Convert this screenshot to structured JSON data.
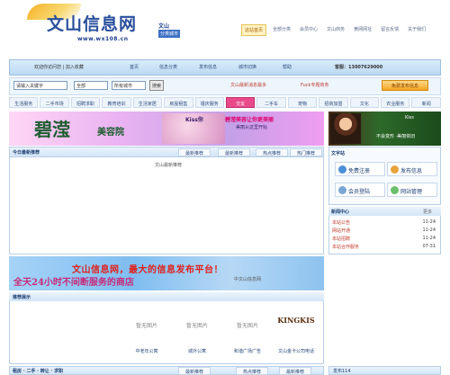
{
  "header": {
    "logo_title": "文山信息网",
    "logo_url": "www.wx108.cn",
    "logo_tag1": "文山",
    "logo_tag2": "分类城市",
    "nav": [
      "这站首页",
      "全部分类",
      "会员中心",
      "文山商务",
      "黄网网址",
      "留言反馈",
      "关于我们"
    ]
  },
  "menubar": {
    "left_text": "欢迎你访问您 | 加入收藏",
    "tabs": [
      "首页",
      "信息分类",
      "发布信息",
      "城市切换",
      "帮助"
    ],
    "phone": "客服：13007629000"
  },
  "search": {
    "input_value": "请输入关键字",
    "select1": "全部",
    "select2": "所有城市",
    "button": "搜索",
    "hint1": "文山最新消息最多",
    "hint2": "Fuck专题商务",
    "post_button": "免费发布信息"
  },
  "categories": [
    "生活服务",
    "二手市场",
    "招聘求职",
    "教育培训",
    "生活家居",
    "房屋租售",
    "婚庆服务",
    "交友",
    "二手车",
    "宠物",
    "招商加盟",
    "文化",
    "农业服务",
    "新闻"
  ],
  "banner": {
    "logo": "碧滢",
    "sub": "美容院",
    "text1": "Kiss你",
    "text2": "碧滢美容让你更美丽",
    "text3": "美丽从这里开始",
    "right_text1": "Kiss",
    "right_text2": "不会变形 ·美丽依旧"
  },
  "listing": {
    "title": "今日最新推荐",
    "tabs": [
      "最新推荐",
      "最新推荐",
      "热点推荐",
      "热门推荐"
    ],
    "empty": "文山最新推荐"
  },
  "sidebar": {
    "head": "文字站",
    "buttons": [
      "免费注册",
      "发布信息",
      "会员登陆",
      "网站管理"
    ],
    "news_title": "新闻中心",
    "news_more": "更多",
    "news": [
      {
        "title": "本站公告",
        "date": "11-24"
      },
      {
        "title": "网站开通",
        "date": "11-24"
      },
      {
        "title": "本站招聘",
        "date": "11-24"
      },
      {
        "title": "本站合作服务",
        "date": "07-31"
      }
    ]
  },
  "big_banner": {
    "text1": "文山信息网，最大的信息发布平台！",
    "text2": "全天24小时不间断服务的商店",
    "text3": "中文山信息网"
  },
  "recommend": {
    "title": "推荐展示",
    "items": [
      {
        "img": "暂无图片",
        "caption": "中老年公寓"
      },
      {
        "img": "暂无图片",
        "caption": "城外公寓"
      },
      {
        "img": "暂无图片",
        "caption": "和谐广场广告"
      },
      {
        "img": "KINGKIS",
        "caption": "文山金卡公司电话"
      }
    ]
  },
  "bottom": {
    "title": "租房 · 二手 · 转让 · 求职",
    "tabs": [
      "最新推荐",
      "热点推荐",
      "最新推荐"
    ],
    "side_title": "发布114"
  }
}
